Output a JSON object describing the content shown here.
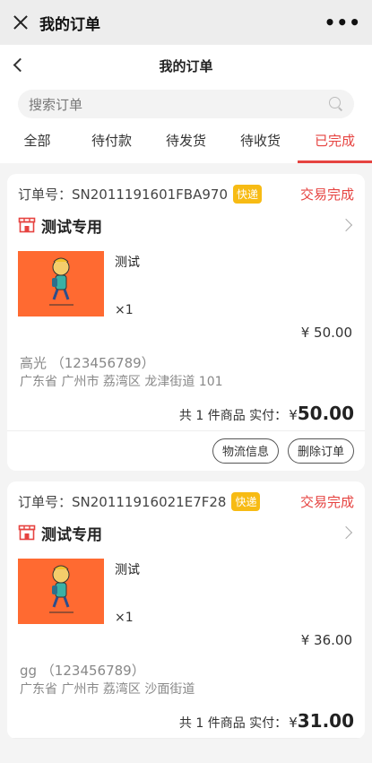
{
  "wechat_bar": {
    "title": "我的订单",
    "more": "•••"
  },
  "nav": {
    "title": "我的订单"
  },
  "search": {
    "placeholder": "搜索订单"
  },
  "tabs": [
    {
      "label": "全部"
    },
    {
      "label": "待付款"
    },
    {
      "label": "待发货"
    },
    {
      "label": "待收货"
    },
    {
      "label": "已完成"
    }
  ],
  "active_tab": "已完成",
  "orders": [
    {
      "order_no": "订单号：SN2011191601FBA970",
      "badge": "快递",
      "status": "交易完成",
      "shop": "测试专用",
      "item_name": "测试",
      "qty": "×1",
      "price": "¥ 50.00",
      "contact": "高光  （123456789）",
      "address": "广东省 广州市 荔湾区 龙津街道 101",
      "total_text": "共 1 件商品  实付：",
      "total_currency": "¥",
      "total_value": "50.00",
      "buttons": [
        "物流信息",
        "删除订单"
      ]
    },
    {
      "order_no": "订单号：SN20111916021E7F28",
      "badge": "快递",
      "status": "交易完成",
      "shop": "测试专用",
      "item_name": "测试",
      "qty": "×1",
      "price": "¥ 36.00",
      "contact": "gg  （123456789）",
      "address": "广东省 广州市 荔湾区 沙面街道",
      "total_text": "共 1 件商品  实付：",
      "total_currency": "¥",
      "total_value": "31.00"
    }
  ],
  "colors": {
    "accent": "#e64340",
    "badge": "#f7bb14",
    "thumb": "#ff6a31"
  }
}
